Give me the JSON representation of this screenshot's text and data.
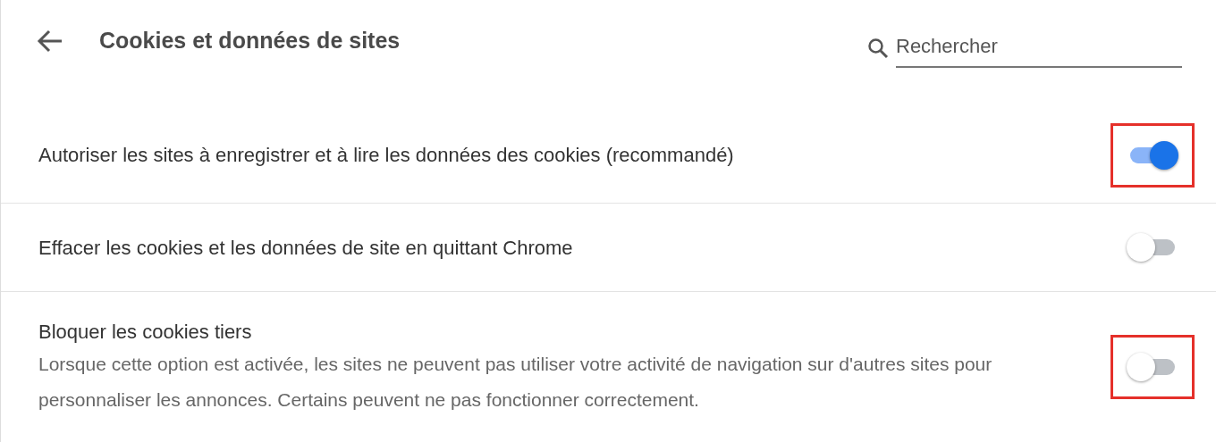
{
  "header": {
    "title": "Cookies et données de sites",
    "search": {
      "placeholder": "Rechercher"
    }
  },
  "settings": [
    {
      "label": "Autoriser les sites à enregistrer et à lire les données des cookies (recommandé)",
      "on": true,
      "highlighted": true
    },
    {
      "label": "Effacer les cookies et les données de site en quittant Chrome",
      "on": false,
      "highlighted": false
    },
    {
      "label": "Bloquer les cookies tiers",
      "description": "Lorsque cette option est activée, les sites ne peuvent pas utiliser votre activité de navigation sur d'autres sites pour personnaliser les annonces. Certains peuvent ne pas fonctionner correctement.",
      "on": false,
      "highlighted": true
    }
  ]
}
